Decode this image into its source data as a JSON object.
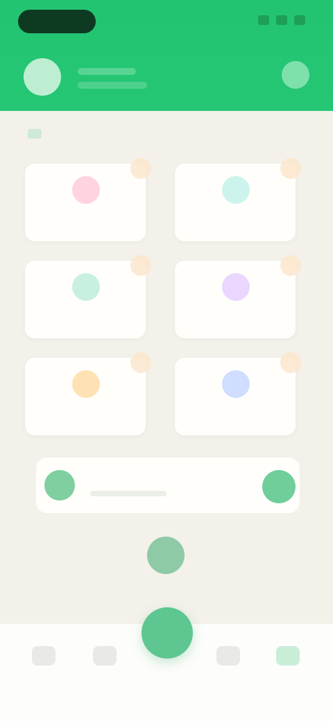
{
  "header": {
    "brand_color": "#22c371",
    "icons": [
      "avatar",
      "settings-icon"
    ]
  },
  "section": {
    "title": "",
    "icon": "folder-icon"
  },
  "grid": [
    {
      "label": "",
      "color": "#ff9cb7",
      "icon": "pink-service-icon"
    },
    {
      "label": "",
      "color": "#7fe0cc",
      "icon": "teal-service-icon"
    },
    {
      "label": "",
      "color": "#74d8ad",
      "icon": "green-service-icon"
    },
    {
      "label": "",
      "color": "#cf97ff",
      "icon": "purple-service-icon"
    },
    {
      "label": "",
      "color": "#ffb74a",
      "icon": "orange-service-icon"
    },
    {
      "label": "",
      "color": "#6f9eff",
      "icon": "blue-service-icon"
    }
  ],
  "banner": {
    "title": "",
    "left_icon": "gift-icon",
    "right_icon": "arrow-button-icon"
  },
  "bottom_nav": {
    "items": [
      "home-icon",
      "discover-icon",
      "add-icon",
      "messages-icon",
      "profile-icon"
    ]
  }
}
